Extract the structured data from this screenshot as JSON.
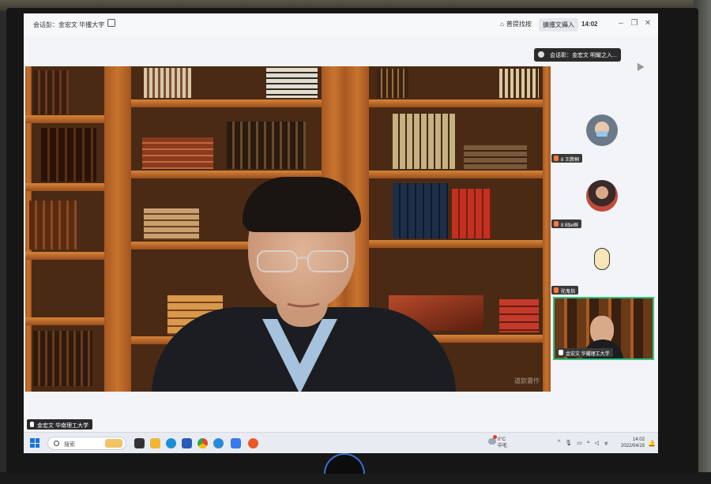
{
  "window": {
    "title": "会话彭：金宏文 毕攫大宇",
    "layout_label": "普提找按",
    "recording_label": "擴攫文攝入",
    "clock": "14:02"
  },
  "tooltip": {
    "text": "会话彰：金宏文 明耀之入..."
  },
  "participants": [
    {
      "name": "8 王脾桐"
    },
    {
      "name": "8 B$e桐"
    },
    {
      "name": "驼鬼指"
    },
    {
      "name": "金宏文 华耀理工大学"
    }
  ],
  "main_speaker": {
    "name_tag": "金宏文 华南理工大学",
    "watermark": "道欽書作"
  },
  "taskbar": {
    "search_placeholder": "搜索",
    "weather_temp": "0°C",
    "weather_text": "中毛",
    "tray_label": "ㅎ",
    "time": "14:02",
    "date": "2022/04/15"
  },
  "colors": {
    "accent": "#1a73d6",
    "active_border": "#2ec27e",
    "mic_orange": "#ff7a3a"
  }
}
